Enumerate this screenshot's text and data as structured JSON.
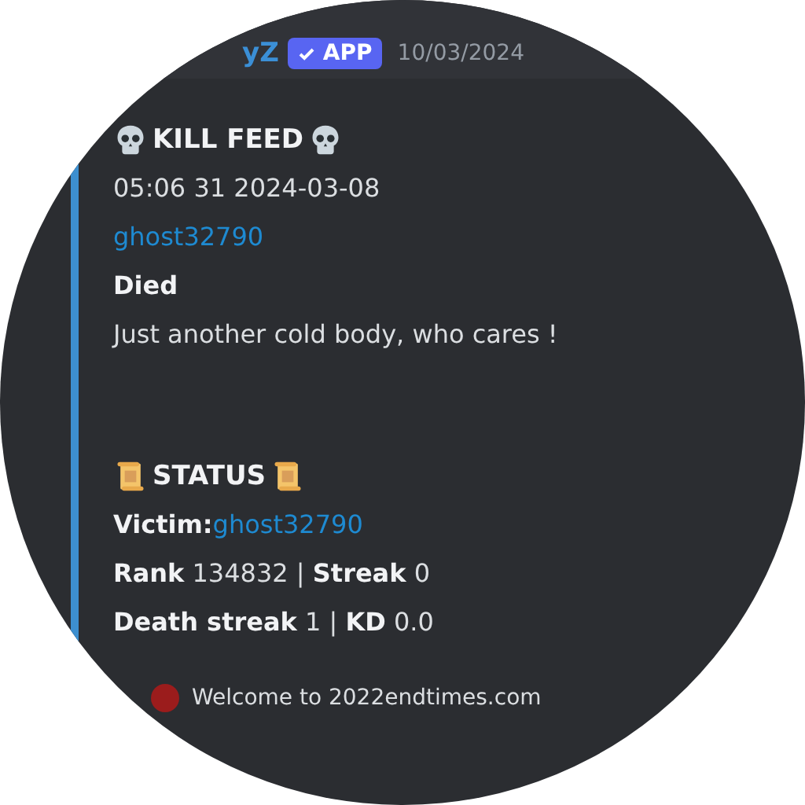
{
  "header": {
    "username": "yZ",
    "badge": "APP",
    "timestamp": "10/03/2024"
  },
  "kill_feed": {
    "title": "KILL FEED",
    "time": "05:06 31 2024-03-08",
    "player": "ghost32790",
    "field_name": "Died",
    "field_value": "Just another cold body, who cares !"
  },
  "status": {
    "title": "STATUS",
    "victim_label": "Victim:",
    "victim": "ghost32790",
    "lines": [
      "**Rank** 134832 | **Streak** 0",
      "**Death streak** 1 | **KD** 0.0"
    ]
  },
  "footer": {
    "text": "Welcome to 2022endtimes.com"
  }
}
